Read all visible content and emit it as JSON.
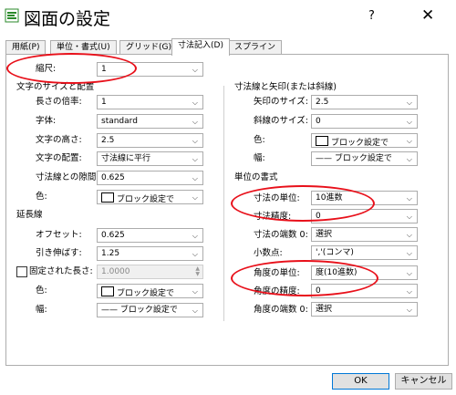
{
  "window": {
    "title": "図面の設定",
    "help": "?",
    "close": "✕"
  },
  "tabs": [
    "用紙(P)",
    "単位・書式(U)",
    "グリッド(G)",
    "寸法記入(D)",
    "スプライン"
  ],
  "scale": {
    "label": "縮尺:",
    "value": "1"
  },
  "text_size": {
    "heading": "文字のサイズと配置",
    "length_factor_label": "長さの倍率:",
    "length_factor_value": "1",
    "font_label": "字体:",
    "font_value": "standard",
    "text_height_label": "文字の高さ:",
    "text_height_value": "2.5",
    "text_placement_label": "文字の配置:",
    "text_placement_value": "寸法線に平行",
    "text_offset_label": "寸法線との隙間:",
    "text_offset_value": "0.625",
    "color_label": "色:",
    "color_value": "ブロック設定で"
  },
  "extension": {
    "heading": "延長線",
    "offset_label": "オフセット:",
    "offset_value": "0.625",
    "extend_label": "引き伸ばす:",
    "extend_value": "1.25",
    "fixed_length_label": "固定された長さ:",
    "fixed_length_value": "1.0000",
    "color_label": "色:",
    "color_value": "ブロック設定で",
    "width_label": "幅:",
    "width_value": "ブロック設定で"
  },
  "arrows": {
    "heading": "寸法線と矢印(または斜線)",
    "arrow_size_label": "矢印のサイズ:",
    "arrow_size_value": "2.5",
    "tick_size_label": "斜線のサイズ:",
    "tick_size_value": "0",
    "color_label": "色:",
    "color_value": "ブロック設定で",
    "width_label": "幅:",
    "width_value": "ブロック設定で"
  },
  "units": {
    "heading": "単位の書式",
    "linear_unit_label": "寸法の単位:",
    "linear_unit_value": "10進数",
    "precision_label": "寸法精度:",
    "precision_value": "0",
    "zero_supp_label": "寸法の端数 0:",
    "zero_supp_value": "選択",
    "decimal_label": "小数点:",
    "decimal_value": "','(コンマ)",
    "angle_unit_label": "角度の単位:",
    "angle_unit_value": "度(10進数)",
    "angle_precision_label": "角度の精度:",
    "angle_precision_value": "0",
    "angle_zero_label": "角度の端数 0:",
    "angle_zero_value": "選択"
  },
  "buttons": {
    "ok": "OK",
    "cancel": "キャンセル"
  },
  "colors": {
    "annotation": "#e8101a",
    "default_border": "#0078d7"
  }
}
